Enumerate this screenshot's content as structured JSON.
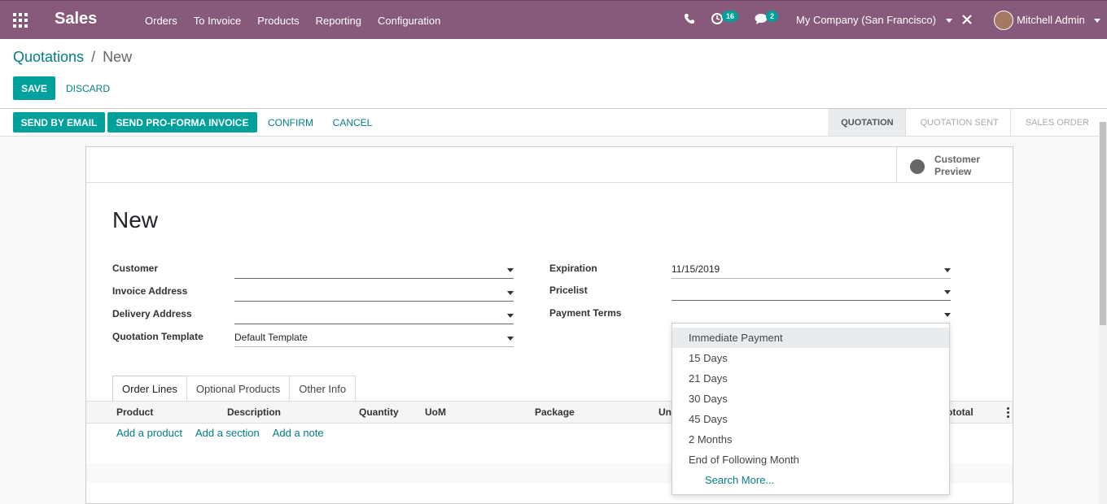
{
  "navbar": {
    "app_name": "Sales",
    "menu": [
      "Orders",
      "To Invoice",
      "Products",
      "Reporting",
      "Configuration"
    ],
    "activity_count": "16",
    "messages_count": "2",
    "company": "My Company (San Francisco)",
    "user": "Mitchell Admin",
    "color": "#875A7B"
  },
  "breadcrumb": {
    "parent": "Quotations",
    "separator": "/",
    "current": "New"
  },
  "actions": {
    "save": "SAVE",
    "discard": "DISCARD"
  },
  "header_buttons": {
    "send_email": "SEND BY EMAIL",
    "send_proforma": "SEND PRO-FORMA INVOICE",
    "confirm": "CONFIRM",
    "cancel": "CANCEL"
  },
  "status": {
    "steps": [
      "QUOTATION",
      "QUOTATION SENT",
      "SALES ORDER"
    ],
    "active": "QUOTATION"
  },
  "preview": {
    "line1": "Customer",
    "line2": "Preview"
  },
  "form": {
    "title": "New",
    "customer_label": "Customer",
    "customer_value": "",
    "invoice_label": "Invoice Address",
    "invoice_value": "",
    "delivery_label": "Delivery Address",
    "delivery_value": "",
    "template_label": "Quotation Template",
    "template_value": "Default Template",
    "expiration_label": "Expiration",
    "expiration_value": "11/15/2019",
    "pricelist_label": "Pricelist",
    "pricelist_value": "",
    "payment_terms_label": "Payment Terms",
    "payment_terms_value": ""
  },
  "tabs": [
    "Order Lines",
    "Optional Products",
    "Other Info"
  ],
  "table": {
    "product": "Product",
    "description": "Description",
    "quantity": "Quantity",
    "uom": "UoM",
    "package": "Package",
    "unit_partial": "Un",
    "subtotal_partial": "ototal"
  },
  "add_links": [
    "Add a product",
    "Add a section",
    "Add a note"
  ],
  "dropdown": {
    "options": [
      "Immediate Payment",
      "15 Days",
      "21 Days",
      "30 Days",
      "45 Days",
      "2 Months",
      "End of Following Month"
    ],
    "highlighted": "Immediate Payment",
    "search_more": "Search More..."
  }
}
